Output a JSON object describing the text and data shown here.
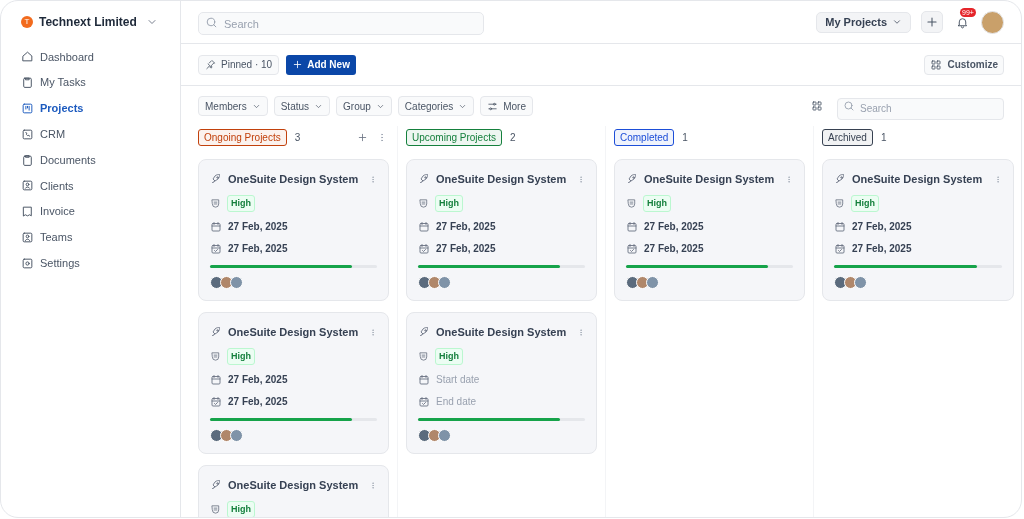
{
  "workspace": {
    "initial": "T",
    "name": "Technext Limited"
  },
  "sidebar": {
    "items": [
      {
        "label": "Dashboard",
        "selected": false
      },
      {
        "label": "My Tasks",
        "selected": false
      },
      {
        "label": "Projects",
        "selected": true
      },
      {
        "label": "CRM",
        "selected": false
      },
      {
        "label": "Documents",
        "selected": false
      },
      {
        "label": "Clients",
        "selected": false
      },
      {
        "label": "Invoice",
        "selected": false
      },
      {
        "label": "Teams",
        "selected": false
      },
      {
        "label": "Settings",
        "selected": false
      }
    ]
  },
  "topbar": {
    "search": {
      "placeholder": "Search"
    },
    "project_select": "My Projects",
    "notification_badge": "99+"
  },
  "toolbar": {
    "pinned": "Pinned · 10",
    "add_button": "Add New",
    "customize_button": "Customize"
  },
  "filters": {
    "items": [
      "Members",
      "Status",
      "Group",
      "Categories"
    ],
    "more": "More",
    "search": {
      "placeholder": "Search"
    }
  },
  "columns": [
    {
      "title": "Ongoing Projects",
      "color": "#c2410c",
      "count": "3",
      "actions": true,
      "cards": [
        {
          "title": "OneSuite Design System",
          "priority": "High",
          "start": {
            "text": "27 Feb, 2025",
            "empty": false
          },
          "end": {
            "text": "27 Feb, 2025",
            "empty": false
          },
          "level": 0.85
        },
        {
          "title": "OneSuite Design System",
          "priority": "High",
          "start": {
            "text": "27 Feb, 2025",
            "empty": false
          },
          "end": {
            "text": "27 Feb, 2025",
            "empty": false
          },
          "level": 0.85
        },
        {
          "title": "OneSuite Design System",
          "priority": "High"
        }
      ]
    },
    {
      "title": "Upcoming Projects",
      "color": "#15803d",
      "count": "2",
      "actions": false,
      "cards": [
        {
          "title": "OneSuite Design System",
          "priority": "High",
          "start": {
            "text": "27 Feb, 2025",
            "empty": false
          },
          "end": {
            "text": "27 Feb, 2025",
            "empty": false
          },
          "level": 0.85
        },
        {
          "title": "OneSuite Design System",
          "priority": "High",
          "start": {
            "text": "Start date",
            "empty": true
          },
          "end": {
            "text": "End date",
            "empty": true
          },
          "level": 0.85
        }
      ]
    },
    {
      "title": "Completed",
      "color": "#1d4ed8",
      "count": "1",
      "actions": false,
      "cards": [
        {
          "title": "OneSuite Design System",
          "priority": "High",
          "start": {
            "text": "27 Feb, 2025",
            "empty": false
          },
          "end": {
            "text": "27 Feb, 2025",
            "empty": false
          },
          "level": 0.85
        }
      ]
    },
    {
      "title": "Archived",
      "color": "#374151",
      "count": "1",
      "actions": false,
      "cards": [
        {
          "title": "OneSuite Design System",
          "priority": "High",
          "start": {
            "text": "27 Feb, 2025",
            "empty": false
          },
          "end": {
            "text": "27 Feb, 2025",
            "empty": false
          },
          "level": 0.85
        }
      ]
    }
  ]
}
